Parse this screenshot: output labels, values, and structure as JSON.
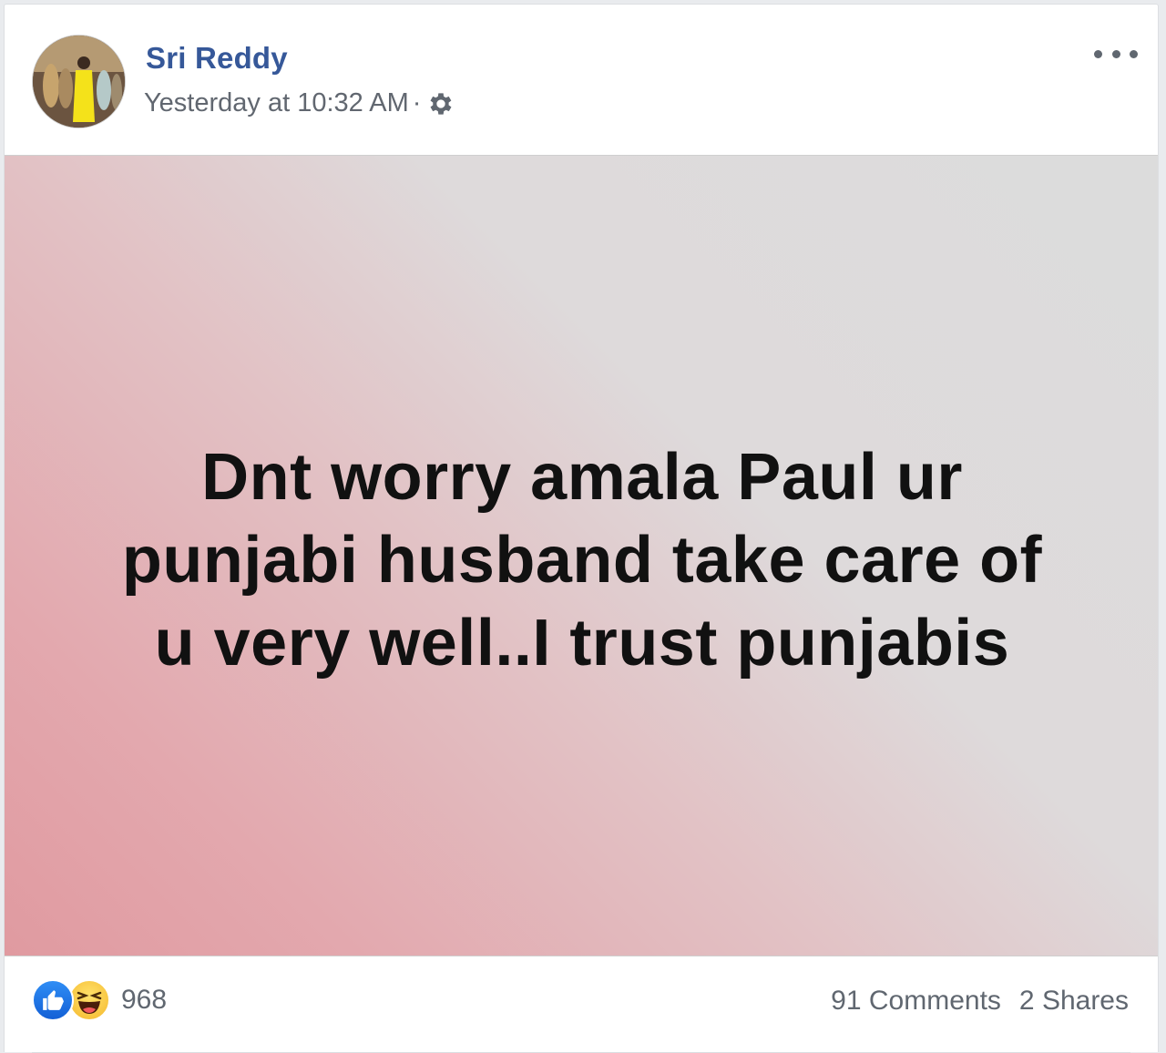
{
  "post": {
    "author": "Sri Reddy",
    "timestamp": "Yesterday at 10:32 AM",
    "separator": "·",
    "privacy_icon": "gear-icon",
    "more_icon": "more-options-icon",
    "text_lines": [
      "Dnt worry amala Paul ur",
      "punjabi husband take care of",
      "u very well..I trust punjabis"
    ]
  },
  "footer": {
    "reaction_icons": [
      "like-icon",
      "haha-icon"
    ],
    "reaction_count": "968",
    "comments": "91 Comments",
    "shares": "2 Shares"
  },
  "colors": {
    "author_link": "#365899",
    "meta_text": "#616770",
    "like_blue": "#1877f2",
    "haha_yellow": "#f7c23a"
  }
}
